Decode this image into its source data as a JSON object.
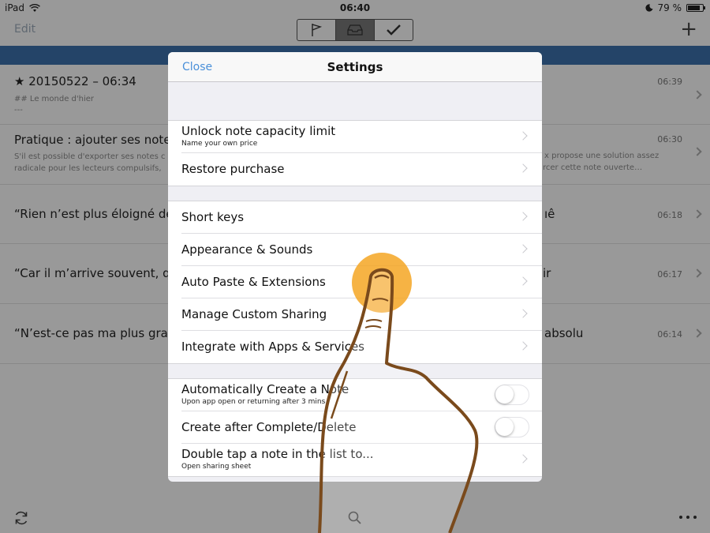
{
  "status_bar": {
    "device": "iPad",
    "time": "06:40",
    "battery": "79 %",
    "battery_level": 0.79
  },
  "nav": {
    "edit_label": "Edit"
  },
  "notes": [
    {
      "title": "★ 20150522 – 06:34",
      "subtitle": "## Le monde d'hier",
      "subtitle2": "---",
      "time": "06:39"
    },
    {
      "title": "Pratique : ajouter ses notes c",
      "subtitle": "S'il est possible d'exporter ses notes c",
      "subtitle2": "radicale pour les lecteurs compulsifs,",
      "right_line1": "x propose une solution assez",
      "right_line2": "rcer cette note ouverte…",
      "time": "06:30"
    },
    {
      "title": "“Rien n’est plus éloigné de m",
      "right_text": "ıê",
      "time": "06:18"
    },
    {
      "title": "“Car il m’arrive souvent, quar",
      "right_text": "ir",
      "time": "06:17"
    },
    {
      "title": "“N’est-ce pas ma plus grande",
      "right_text": "absolu",
      "time": "06:14"
    }
  ],
  "modal": {
    "close_label": "Close",
    "title": "Settings",
    "group1": [
      {
        "label": "Unlock note capacity limit",
        "sublabel": "Name your own price"
      },
      {
        "label": "Restore purchase"
      }
    ],
    "group2": [
      {
        "label": "Short keys"
      },
      {
        "label": "Appearance & Sounds"
      },
      {
        "label": "Auto Paste & Extensions"
      },
      {
        "label": "Manage Custom Sharing"
      },
      {
        "label": "Integrate with Apps & Services"
      }
    ],
    "group3": [
      {
        "label": "Automatically Create a Note",
        "sublabel": "Upon app open or returning after 3 mins",
        "toggle_on": false
      },
      {
        "label": "Create after Complete/Delete",
        "toggle_on": false
      },
      {
        "label": "Double tap a note in the list to...",
        "sublabel": "Open sharing sheet"
      }
    ]
  },
  "colors": {
    "accent": "#4a90d9",
    "strip": "#3b6ea8",
    "tap_highlight": "#f5a623",
    "hand_outline": "#7a4a1c"
  },
  "icons": [
    "wifi-icon",
    "moon-icon",
    "flag-icon",
    "inbox-icon",
    "checkmark-icon",
    "plus-icon",
    "sync-icon",
    "search-icon",
    "more-icon",
    "chevron-right-icon"
  ]
}
